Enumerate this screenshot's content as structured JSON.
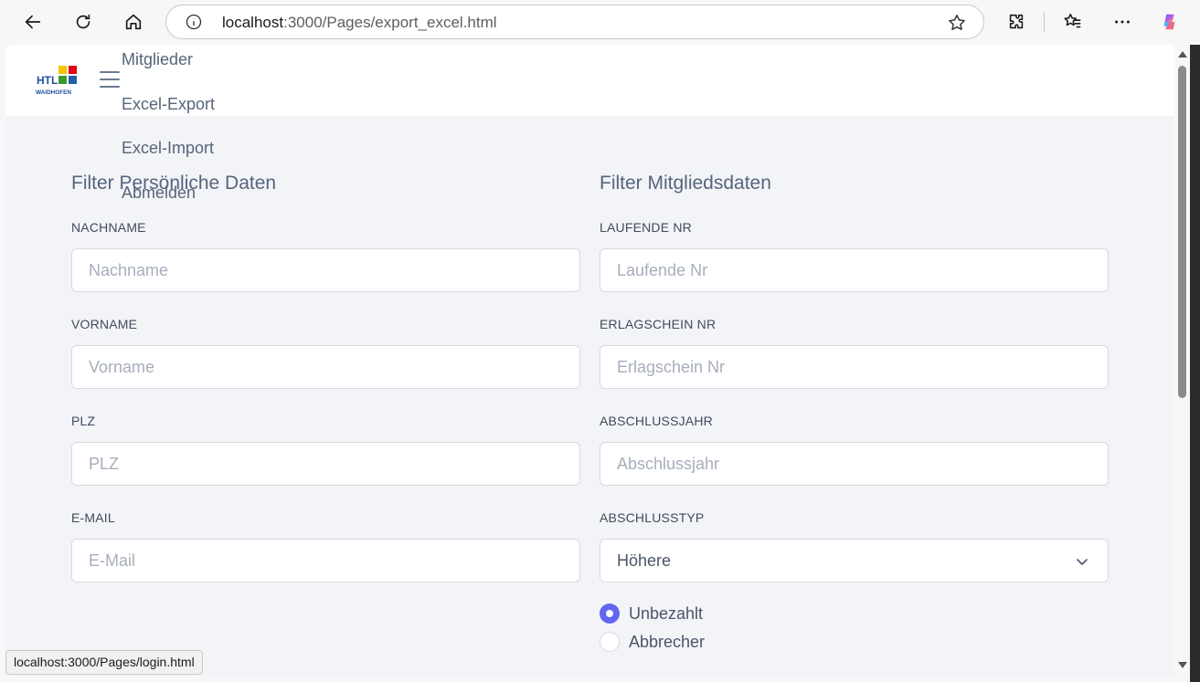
{
  "browser": {
    "url_host": "localhost",
    "url_rest": ":3000/Pages/export_excel.html",
    "status_url": "localhost:3000/Pages/login.html"
  },
  "nav": {
    "items": [
      "Mitglieder",
      "Excel-Export",
      "Excel-Import",
      "Abmelden"
    ]
  },
  "personal": {
    "title": "Filter Persönliche Daten",
    "fields": [
      {
        "label": "NACHNAME",
        "placeholder": "Nachname",
        "value": ""
      },
      {
        "label": "VORNAME",
        "placeholder": "Vorname",
        "value": ""
      },
      {
        "label": "PLZ",
        "placeholder": "PLZ",
        "value": ""
      },
      {
        "label": "E-MAIL",
        "placeholder": "E-Mail",
        "value": ""
      }
    ]
  },
  "member": {
    "title": "Filter Mitgliedsdaten",
    "fields": [
      {
        "label": "LAUFENDE NR",
        "placeholder": "Laufende Nr",
        "value": ""
      },
      {
        "label": "ERLAGSCHEIN NR",
        "placeholder": "Erlagschein Nr",
        "value": ""
      },
      {
        "label": "ABSCHLUSSJAHR",
        "placeholder": "Abschlussjahr",
        "value": ""
      }
    ],
    "abschlusstyp_label": "ABSCHLUSSTYP",
    "abschlusstyp_value": "Höhere",
    "radios": [
      {
        "label": "Unbezahlt",
        "checked": true
      },
      {
        "label": "Abbrecher",
        "checked": false
      }
    ]
  },
  "colors": {
    "accent": "#6366f1",
    "text": "#55657c",
    "bg": "#f3f4f7"
  },
  "icons": [
    "back-icon",
    "reload-icon",
    "home-icon",
    "info-icon",
    "star-icon",
    "extensions-icon",
    "favorites-icon",
    "more-icon",
    "copilot-icon",
    "hamburger-icon",
    "chevron-down-icon"
  ]
}
